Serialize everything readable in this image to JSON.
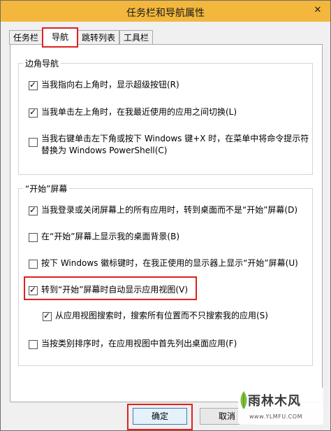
{
  "window": {
    "title": "任务栏和导航属性",
    "close_glyph": "✕"
  },
  "tabs": [
    {
      "label": "任务栏",
      "active": false
    },
    {
      "label": "导航",
      "active": true
    },
    {
      "label": "跳转列表",
      "active": false
    },
    {
      "label": "工具栏",
      "active": false
    }
  ],
  "corner_group": {
    "title": "边角导航",
    "options": [
      {
        "label": "当我指向右上角时，显示超级按钮(R)",
        "checked": true
      },
      {
        "label": "当我单击左上角时，在我最近使用的应用之间切换(L)",
        "checked": true
      },
      {
        "label_line1": "当我右键单击左下角或按下 Windows 键+X 时，在菜单中将命令提示符",
        "label_line2": "替换为 Windows PowerShell(C)",
        "checked": false
      }
    ]
  },
  "start_group": {
    "title": "“开始”屏幕",
    "options": [
      {
        "label": "当我登录或关闭屏幕上的所有应用时，转到桌面而不是“开始”屏幕(D)",
        "checked": true
      },
      {
        "label": "在“开始”屏幕上显示我的桌面背景(B)",
        "checked": false
      },
      {
        "label": "按下 Windows 徽标键时，在我正使用的显示器上显示“开始”屏幕(U)",
        "checked": false
      },
      {
        "label": "转到“开始”屏幕时自动显示应用视图(V)",
        "checked": true
      },
      {
        "label": "从应用视图搜索时，搜索所有位置而不只搜索我的应用(S)",
        "checked": true
      },
      {
        "label": "当按类别排序时，在应用视图中首先列出桌面应用(F)",
        "checked": false
      }
    ]
  },
  "buttons": {
    "ok": "确定",
    "cancel": "取消"
  },
  "watermark": {
    "main": "雨林木风",
    "sub": "www.YLMFU.COM"
  },
  "colors": {
    "titlebar": "#f2b73c",
    "highlight": "#e02020"
  }
}
